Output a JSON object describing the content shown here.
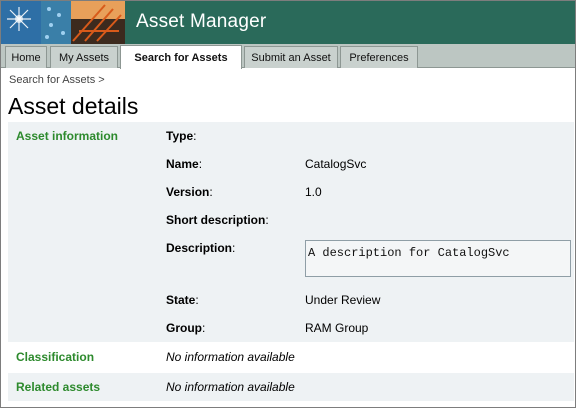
{
  "app": {
    "title": "Asset Manager"
  },
  "nav": {
    "tabs": [
      {
        "label": "Home"
      },
      {
        "label": "My Assets"
      },
      {
        "label": "Search for Assets",
        "active": true
      },
      {
        "label": "Submit an Asset"
      },
      {
        "label": "Preferences"
      }
    ]
  },
  "breadcrumb": {
    "link": "Search for Assets",
    "separator": ">"
  },
  "page": {
    "title": "Asset details"
  },
  "asset_information": {
    "heading": "Asset information",
    "type_label": "Type",
    "name_label": "Name",
    "name_value": "CatalogSvc",
    "version_label": "Version",
    "version_value": "1.0",
    "short_description_label": "Short description",
    "description_label": "Description",
    "description_value": "A description for CatalogSvc",
    "state_label": "State",
    "state_value": "Under Review",
    "group_label": "Group",
    "group_value": "RAM Group"
  },
  "classification": {
    "heading": "Classification",
    "value": "No information available"
  },
  "related_assets": {
    "heading": "Related assets",
    "value": "No information available"
  },
  "colors": {
    "header": "#2a6a5a",
    "section_heading": "#2d8a2d",
    "panel": "#eef2f4",
    "nav": "#bcc6c2"
  }
}
